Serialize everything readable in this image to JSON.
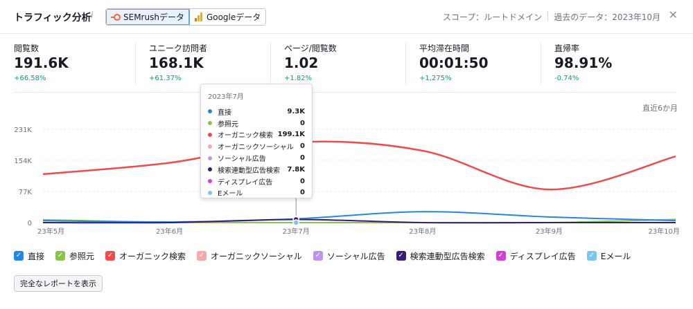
{
  "header": {
    "title": "トラフィック分析",
    "info_glyph": "i",
    "sources": [
      {
        "label": "SEMrushデータ",
        "active": true
      },
      {
        "label": "Googleデータ",
        "active": false
      }
    ],
    "scope": "スコープ：ルートドメイン",
    "period": "過去のデータ：2023年10月",
    "close_glyph": "✕"
  },
  "metrics": [
    {
      "label": "閲覧数",
      "value": "191.6K",
      "delta": "+66.58%"
    },
    {
      "label": "ユニーク訪問者",
      "value": "168.1K",
      "delta": "+61.37%"
    },
    {
      "label": "ページ/閲覧数",
      "value": "1.02",
      "delta": "+1.82%"
    },
    {
      "label": "平均滞在時間",
      "value": "00:01:50",
      "delta": "+1,275%"
    },
    {
      "label": "直帰率",
      "value": "98.91%",
      "delta": "-0.74%"
    }
  ],
  "chart_period": "直近6か月",
  "colors": {
    "direct": "#1e88e5",
    "referral": "#8bc34a",
    "organic": "#ef4b4f",
    "organic_social": "#f7a8a8",
    "social_ads": "#c192f0",
    "search_ads": "#3a1a78",
    "display_ads": "#d63fd6",
    "email": "#7cc6f2"
  },
  "chart_data": {
    "type": "line",
    "categories": [
      "23年5月",
      "23年6月",
      "23年7月",
      "23年8月",
      "23年9月",
      "23年10月"
    ],
    "y_ticks": [
      "0",
      "77K",
      "154K",
      "231K"
    ],
    "ylim": [
      0,
      231000
    ],
    "series": [
      {
        "name": "直接",
        "values": [
          5000,
          1500,
          9300,
          27000,
          14000,
          5000
        ]
      },
      {
        "name": "参照元",
        "values": [
          7000,
          1000,
          0,
          0,
          0,
          8000
        ]
      },
      {
        "name": "オーガニック検索",
        "values": [
          120000,
          148000,
          199100,
          178000,
          82000,
          164000
        ]
      },
      {
        "name": "オーガニックソーシャル",
        "values": [
          0,
          0,
          0,
          0,
          0,
          0
        ]
      },
      {
        "name": "ソーシャル広告",
        "values": [
          0,
          0,
          0,
          0,
          0,
          0
        ]
      },
      {
        "name": "検索連動型広告検索",
        "values": [
          0,
          0,
          7800,
          0,
          0,
          0
        ]
      },
      {
        "name": "ディスプレイ広告",
        "values": [
          0,
          0,
          0,
          0,
          0,
          0
        ]
      },
      {
        "name": "Eメール",
        "values": [
          0,
          0,
          0,
          0,
          0,
          0
        ]
      }
    ],
    "tooltip": {
      "title": "2023年7月",
      "rows": [
        {
          "name": "直接",
          "value": "9.3K"
        },
        {
          "name": "参照元",
          "value": "0"
        },
        {
          "name": "オーガニック検索",
          "value": "199.1K"
        },
        {
          "name": "オーガニックソーシャル",
          "value": "0"
        },
        {
          "name": "ソーシャル広告",
          "value": "0"
        },
        {
          "name": "検索連動型広告検索",
          "value": "7.8K"
        },
        {
          "name": "ディスプレイ広告",
          "value": "0"
        },
        {
          "name": "Eメール",
          "value": "0"
        }
      ]
    }
  },
  "legend": [
    {
      "label": "直接",
      "color": "#1e88e5"
    },
    {
      "label": "参照元",
      "color": "#8bc34a"
    },
    {
      "label": "オーガニック検索",
      "color": "#ef4b4f"
    },
    {
      "label": "オーガニックソーシャル",
      "color": "#f7a8a8"
    },
    {
      "label": "ソーシャル広告",
      "color": "#c192f0"
    },
    {
      "label": "検索連動型広告検索",
      "color": "#3a1a78"
    },
    {
      "label": "ディスプレイ広告",
      "color": "#d63fd6"
    },
    {
      "label": "Eメール",
      "color": "#7cc6f2"
    }
  ],
  "footer": {
    "report_button": "完全なレポートを表示"
  }
}
